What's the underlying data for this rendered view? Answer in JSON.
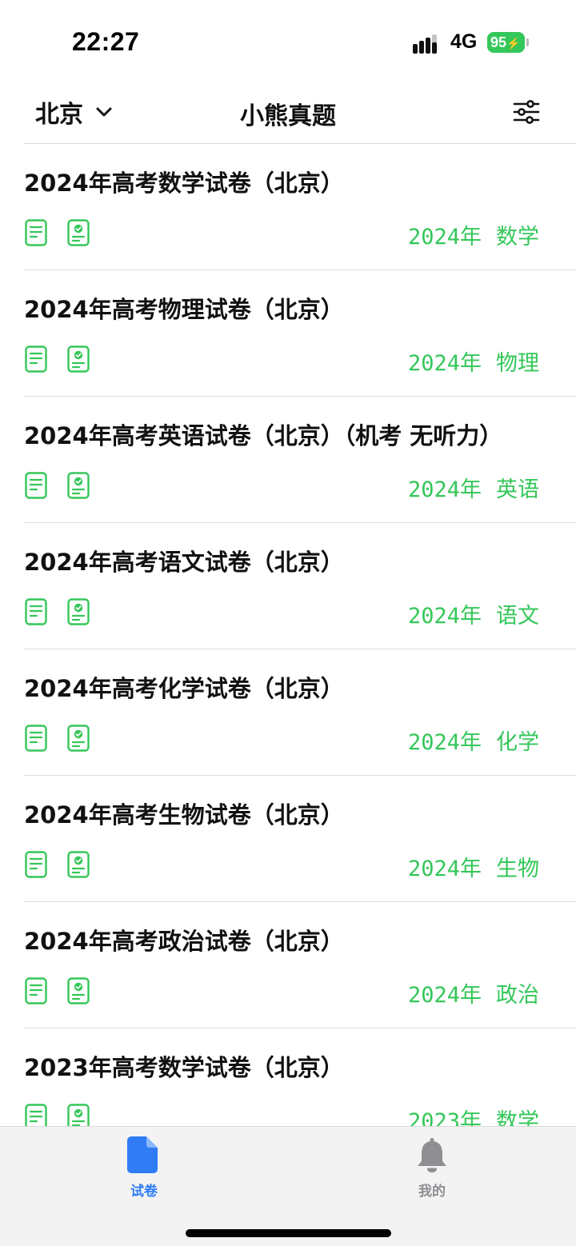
{
  "status_bar": {
    "time": "22:27",
    "network": "4G",
    "battery": "95",
    "signal_icon": "signal-bars-icon",
    "battery_icon": "battery-charging-icon"
  },
  "nav": {
    "city": "北京",
    "city_icon": "chevron-down-icon",
    "title": "小熊真题",
    "filter_icon": "sliders-icon"
  },
  "colors": {
    "accent_green": "#34c759",
    "tab_active_blue": "#2f7cf6",
    "tab_inactive_gray": "#8e8e93"
  },
  "papers": [
    {
      "title": "2024年高考数学试卷（北京）",
      "year": "2024年",
      "subject": "数学"
    },
    {
      "title": "2024年高考物理试卷（北京）",
      "year": "2024年",
      "subject": "物理"
    },
    {
      "title": "2024年高考英语试卷（北京）（机考 无听力）",
      "year": "2024年",
      "subject": "英语"
    },
    {
      "title": "2024年高考语文试卷（北京）",
      "year": "2024年",
      "subject": "语文"
    },
    {
      "title": "2024年高考化学试卷（北京）",
      "year": "2024年",
      "subject": "化学"
    },
    {
      "title": "2024年高考生物试卷（北京）",
      "year": "2024年",
      "subject": "生物"
    },
    {
      "title": "2024年高考政治试卷（北京）",
      "year": "2024年",
      "subject": "政治"
    },
    {
      "title": "2023年高考数学试卷（北京）",
      "year": "2023年",
      "subject": "数学"
    }
  ],
  "tabs": [
    {
      "label": "试卷",
      "icon": "document-icon",
      "active": true
    },
    {
      "label": "我的",
      "icon": "bell-icon",
      "active": false
    }
  ]
}
